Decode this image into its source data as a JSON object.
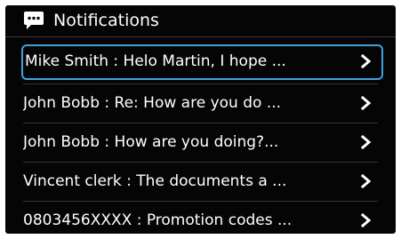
{
  "header": {
    "icon": "chat-bubble-icon",
    "title": "Notifications"
  },
  "notifications": [
    {
      "text": "Mike Smith : Helo Martin, I hope ...",
      "selected": true
    },
    {
      "text": "John Bobb : Re: How are you do ...",
      "selected": false
    },
    {
      "text": "John Bobb : How are you doing?...",
      "selected": false
    },
    {
      "text": "Vincent clerk : The documents a ...",
      "selected": false
    },
    {
      "text": "0803456XXXX : Promotion codes ...",
      "selected": false
    }
  ],
  "colors": {
    "background": "#050505",
    "selection_border": "#3ea3df",
    "text": "#ffffff",
    "divider": "#333333"
  },
  "arrow_icon": "chevron-right-icon"
}
